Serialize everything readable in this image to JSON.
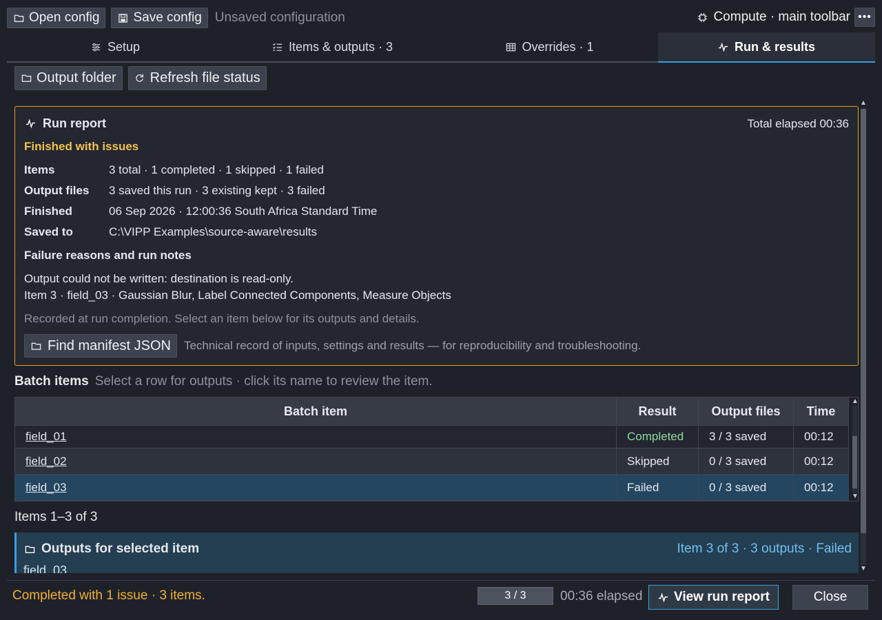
{
  "toolbar": {
    "open_label": "Open config",
    "save_label": "Save config",
    "unsaved_text": "Unsaved configuration",
    "compute_label": "Compute · main toolbar",
    "more_label": "•••"
  },
  "tabs": [
    {
      "label": "Setup",
      "icon": "sliders-icon",
      "active": false
    },
    {
      "label": "Items & outputs · 3",
      "icon": "list-check-icon",
      "active": false
    },
    {
      "label": "Overrides · 1",
      "icon": "grid-icon",
      "active": false
    },
    {
      "label": "Run & results",
      "icon": "pulse-icon",
      "active": true
    }
  ],
  "actions": {
    "output_folder": "Output folder",
    "refresh": "Refresh file status"
  },
  "report": {
    "title": "Run report",
    "elapsed": "Total elapsed 00:36",
    "status": "Finished with issues",
    "rows": [
      {
        "key": "Items",
        "value": "3 total · 1 completed · 1 skipped · 1 failed"
      },
      {
        "key": "Output files",
        "value": "3 saved this run · 3 existing kept · 3 failed"
      },
      {
        "key": "Finished",
        "value": "06 Sep 2026 · 12:00:36 South Africa Standard Time"
      },
      {
        "key": "Saved to",
        "value": "C:\\VIPP Examples\\source-aware\\results"
      }
    ],
    "notes_title": "Failure reasons and run notes",
    "notes": [
      "Output could not be written: destination is read-only.",
      "Item 3 · field_03 · Gaussian Blur, Label Connected Components, Measure Objects"
    ],
    "recorded": "Recorded at run completion. Select an item below for its outputs and details.",
    "manifest_button": "Find manifest JSON",
    "manifest_desc": "Technical record of inputs, settings and results — for reproducibility and troubleshooting."
  },
  "batch": {
    "title": "Batch items",
    "subtitle": "Select a row for outputs · click its name to review the item.",
    "columns": [
      "Batch item",
      "Result",
      "Output files",
      "Time"
    ],
    "rows": [
      {
        "name": "field_01",
        "result": "Completed",
        "outputs": "3 / 3 saved",
        "time": "00:12"
      },
      {
        "name": "field_02",
        "result": "Skipped",
        "outputs": "0 / 3 saved",
        "time": "00:12"
      },
      {
        "name": "field_03",
        "result": "Failed",
        "outputs": "0 / 3 saved",
        "time": "00:12"
      }
    ],
    "count": "Items 1–3 of 3"
  },
  "outputs": {
    "title": "Outputs for selected item",
    "meta": "Item 3 of 3 · 3 outputs · Failed",
    "name": "field_03"
  },
  "footer": {
    "status": "Completed with 1 issue · 3 items.",
    "progress": "3 / 3",
    "elapsed": "00:36 elapsed",
    "view_report": "View run report",
    "close": "Close"
  },
  "colors": {
    "accent": "#3aa0e0",
    "warning": "#f2c14e",
    "success": "#8fd8a0",
    "report_border": "#e0a020"
  }
}
